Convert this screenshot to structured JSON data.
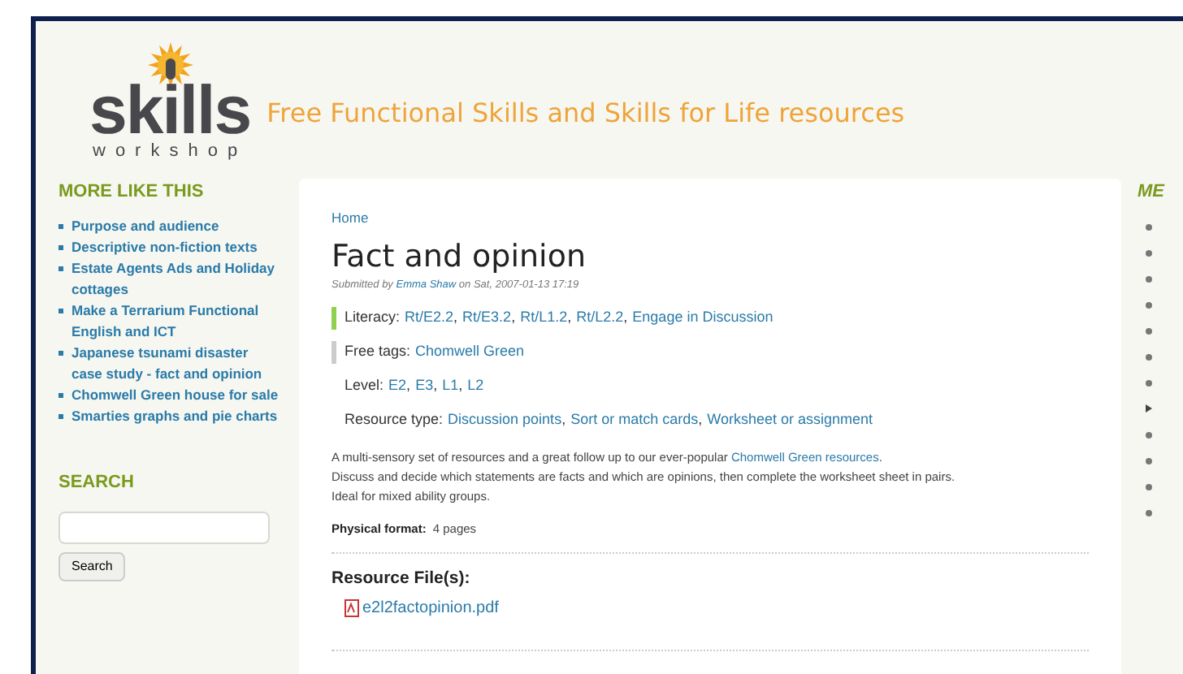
{
  "header": {
    "logo_word": "skills",
    "logo_sub": "workshop",
    "tagline": "Free Functional Skills and Skills for Life resources"
  },
  "sidebar": {
    "more_heading": "MORE LIKE THIS",
    "more_items": [
      "Purpose and audience",
      "Descriptive non-fiction texts",
      "Estate Agents Ads and Holiday cottages",
      "Make a Terrarium Functional English and ICT",
      "Japanese tsunami disaster case study - fact and opinion",
      "Chomwell Green house for sale",
      "Smarties graphs and pie charts"
    ],
    "search_heading": "SEARCH",
    "search_button": "Search"
  },
  "content": {
    "breadcrumb": "Home",
    "title": "Fact and opinion",
    "submitted_prefix": "Submitted by",
    "author": "Emma Shaw",
    "submitted_suffix": "on Sat, 2007-01-13 17:19",
    "taxonomy": [
      {
        "label": "Literacy:",
        "separator": ",",
        "color": "#8fd14f",
        "terms": [
          "Rt/E2.2",
          "Rt/E3.2",
          "Rt/L1.2",
          "Rt/L2.2",
          "Engage in Discussion"
        ]
      },
      {
        "label": "Free tags:",
        "color": "#cccccc",
        "terms": [
          "Chomwell Green"
        ]
      },
      {
        "label": "Level:",
        "separator": ",",
        "terms": [
          "E2",
          "E3",
          "L1",
          "L2"
        ]
      },
      {
        "label": "Resource type:",
        "separator": ",",
        "terms": [
          "Discussion points",
          "Sort or match cards",
          "Worksheet or assignment"
        ]
      }
    ],
    "description_1": "A multi-sensory set of resources and a great follow up to our ever-popular",
    "description_link": "Chomwell Green resources",
    "description_1_end": ".",
    "description_2": "Discuss and decide which statements are facts and which are opinions, then complete the worksheet sheet in pairs.",
    "description_3": "Ideal for mixed ability groups.",
    "format_label": "Physical format:",
    "format_value": "4 pages",
    "files_heading": "Resource File(s):",
    "file_name": "e2l2factopinion.pdf"
  },
  "right_column": {
    "heading": "ME",
    "items": [
      {
        "kind": "bullet"
      },
      {
        "kind": "bullet"
      },
      {
        "kind": "bullet"
      },
      {
        "kind": "bullet"
      },
      {
        "kind": "bullet"
      },
      {
        "kind": "bullet"
      },
      {
        "kind": "bullet"
      },
      {
        "kind": "arrow"
      },
      {
        "kind": "bullet"
      },
      {
        "kind": "bullet"
      },
      {
        "kind": "bullet"
      },
      {
        "kind": "bullet"
      }
    ]
  }
}
